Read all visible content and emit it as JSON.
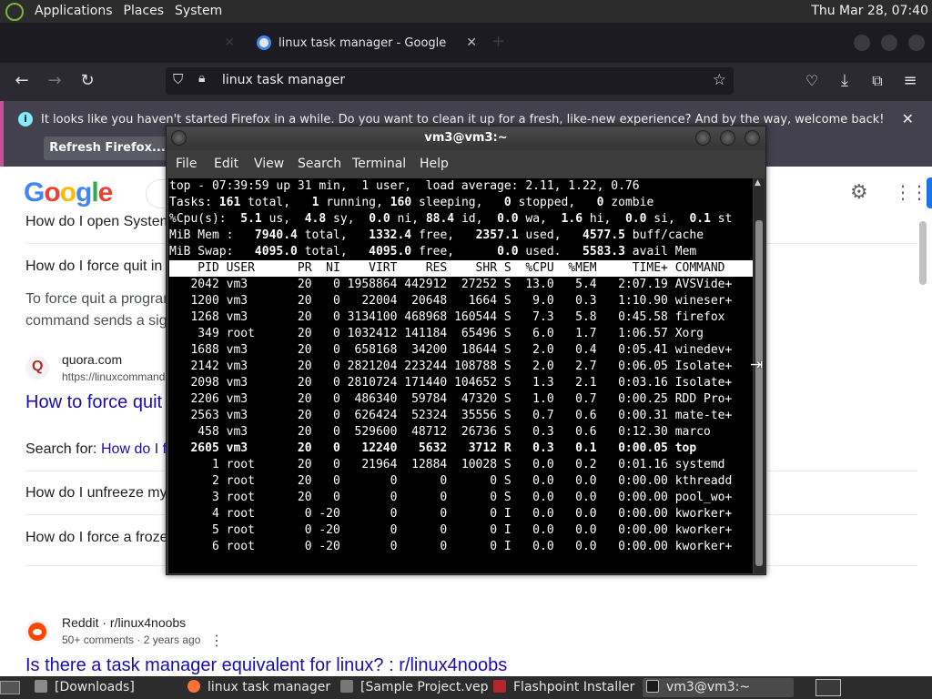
{
  "top_panel": {
    "menus": [
      "Applications",
      "Places",
      "System"
    ],
    "clock": "Thu Mar 28, 07:40"
  },
  "firefox": {
    "tabs": [
      {
        "label": "linux task manager - Google",
        "active": true
      }
    ],
    "urlbar": {
      "text": "linux task manager"
    },
    "notification": {
      "message": "It looks like you haven't started Firefox in a while. Do you want to clean it up for a fresh, like-new experience? And by the way, welcome back!",
      "button": "Refresh Firefox..."
    }
  },
  "google": {
    "logo": [
      "G",
      "o",
      "o",
      "g",
      "l",
      "e"
    ],
    "results": {
      "q1": "How do I open System",
      "q2": "How do I force quit in",
      "snippet1": "To force quit a program",
      "snippet2": "command sends a sig",
      "quora_name": "quora.com",
      "quora_url": "https://linuxcommand",
      "quora_title": "How to force quit",
      "search_for_prefix": "Search for:",
      "search_for_link": "How do I f",
      "q3": "How do I unfreeze my",
      "q4": "How do I force a froze",
      "reddit_source": "Reddit · r/linux4noobs",
      "reddit_meta": "50+ comments · 2 years ago",
      "reddit_title": "Is there a task manager equivalent for linux? : r/linux4noobs"
    }
  },
  "terminal": {
    "title": "vm3@vm3:~",
    "menu": [
      "File",
      "Edit",
      "View",
      "Search",
      "Terminal",
      "Help"
    ],
    "summary": {
      "line1": "top - 07:39:59 up 31 min,  1 user,  load average: 2.11, 1.22, 0.76",
      "tasks": {
        "total": "161",
        "running": "1",
        "sleeping": "160",
        "stopped": "0",
        "zombie": "0"
      },
      "cpu": {
        "us": "5.1",
        "sy": "4.8",
        "ni": "0.0",
        "id": "88.4",
        "wa": "0.0",
        "hi": "1.6",
        "si": "0.0",
        "st": "0.1"
      },
      "mem": {
        "total": "7940.4",
        "free": "1332.4",
        "used": "2357.1",
        "buff_cache": "4577.5"
      },
      "swap": {
        "total": "4095.0",
        "free": "4095.0",
        "used": "0.0",
        "avail_mem": "5583.3"
      }
    },
    "columns": [
      "PID",
      "USER",
      "PR",
      "NI",
      "VIRT",
      "RES",
      "SHR",
      "S",
      "%CPU",
      "%MEM",
      "TIME+",
      "COMMAND"
    ],
    "processes": [
      [
        "2042",
        "vm3",
        "20",
        "0",
        "1958864",
        "442912",
        "27252",
        "S",
        "13.0",
        "5.4",
        "2:07.19",
        "AVSVide+"
      ],
      [
        "1200",
        "vm3",
        "20",
        "0",
        "22004",
        "20648",
        "1664",
        "S",
        "9.0",
        "0.3",
        "1:10.90",
        "wineser+"
      ],
      [
        "1268",
        "vm3",
        "20",
        "0",
        "3134100",
        "468968",
        "160544",
        "S",
        "7.3",
        "5.8",
        "0:45.58",
        "firefox"
      ],
      [
        "349",
        "root",
        "20",
        "0",
        "1032412",
        "141184",
        "65496",
        "S",
        "6.0",
        "1.7",
        "1:06.57",
        "Xorg"
      ],
      [
        "1688",
        "vm3",
        "20",
        "0",
        "658168",
        "34200",
        "18644",
        "S",
        "2.0",
        "0.4",
        "0:05.41",
        "winedev+"
      ],
      [
        "2142",
        "vm3",
        "20",
        "0",
        "2821204",
        "223244",
        "108788",
        "S",
        "2.0",
        "2.7",
        "0:06.05",
        "Isolate+"
      ],
      [
        "2098",
        "vm3",
        "20",
        "0",
        "2810724",
        "171440",
        "104652",
        "S",
        "1.3",
        "2.1",
        "0:03.16",
        "Isolate+"
      ],
      [
        "2206",
        "vm3",
        "20",
        "0",
        "486340",
        "59784",
        "47320",
        "S",
        "1.0",
        "0.7",
        "0:00.25",
        "RDD Pro+"
      ],
      [
        "2563",
        "vm3",
        "20",
        "0",
        "626424",
        "52324",
        "35556",
        "S",
        "0.7",
        "0.6",
        "0:00.31",
        "mate-te+"
      ],
      [
        "458",
        "vm3",
        "20",
        "0",
        "529600",
        "48712",
        "26736",
        "S",
        "0.3",
        "0.6",
        "0:12.30",
        "marco"
      ],
      [
        "2605",
        "vm3",
        "20",
        "0",
        "12240",
        "5632",
        "3712",
        "R",
        "0.3",
        "0.1",
        "0:00.05",
        "top"
      ],
      [
        "1",
        "root",
        "20",
        "0",
        "21964",
        "12884",
        "10028",
        "S",
        "0.0",
        "0.2",
        "0:01.16",
        "systemd"
      ],
      [
        "2",
        "root",
        "20",
        "0",
        "0",
        "0",
        "0",
        "S",
        "0.0",
        "0.0",
        "0:00.00",
        "kthreadd"
      ],
      [
        "3",
        "root",
        "20",
        "0",
        "0",
        "0",
        "0",
        "S",
        "0.0",
        "0.0",
        "0:00.00",
        "pool_wo+"
      ],
      [
        "4",
        "root",
        "0",
        "-20",
        "0",
        "0",
        "0",
        "I",
        "0.0",
        "0.0",
        "0:00.00",
        "kworker+"
      ],
      [
        "5",
        "root",
        "0",
        "-20",
        "0",
        "0",
        "0",
        "I",
        "0.0",
        "0.0",
        "0:00.00",
        "kworker+"
      ],
      [
        "6",
        "root",
        "0",
        "-20",
        "0",
        "0",
        "0",
        "I",
        "0.0",
        "0.0",
        "0:00.00",
        "kworker+"
      ]
    ],
    "bold_pid": "2605"
  },
  "taskbar": {
    "tasks": [
      {
        "label": "[Downloads]"
      },
      {
        "label": "linux task manager ..."
      },
      {
        "label": "[Sample Project.vep..."
      },
      {
        "label": "Flashpoint Installer"
      },
      {
        "label": "vm3@vm3:~",
        "active": true
      }
    ]
  },
  "colors": {
    "panel_bg": "#2c2c2c",
    "firefox_dark": "#1c1b22",
    "notification_bg": "#42414d",
    "google_link": "#1a0dab",
    "terminal_bg": "#000000"
  }
}
